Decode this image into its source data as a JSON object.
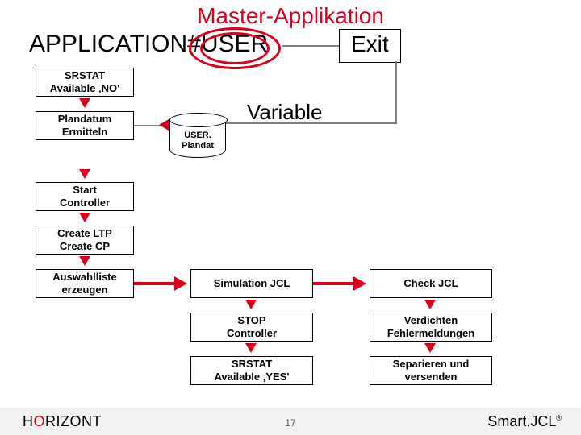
{
  "title": "Master-Applikation",
  "subtitle": "APPLICATION#USER",
  "exit_label": "Exit",
  "variable_label": "Variable",
  "db": {
    "line1": "USER.",
    "line2": "Plandat"
  },
  "left_boxes": {
    "b1": {
      "l1": "SRSTAT",
      "l2": "Available ‚NO'"
    },
    "b2": {
      "l1": "Plandatum",
      "l2": "Ermitteln"
    },
    "b3": {
      "l1": "Start",
      "l2": "Controller"
    },
    "b4": {
      "l1": "Create LTP",
      "l2": "Create CP"
    },
    "b5": {
      "l1": "Auswahlliste",
      "l2": "erzeugen"
    }
  },
  "mid_boxes": {
    "m1": "Simulation JCL",
    "m2a": "STOP",
    "m2b": "Controller",
    "m3a": "SRSTAT",
    "m3b": "Available ‚YES'"
  },
  "right_boxes": {
    "r1": "Check JCL",
    "r2a": "Verdichten",
    "r2b": "Fehlermeldungen",
    "r3a": "Separieren und",
    "r3b": "versenden"
  },
  "footer": {
    "brand_left_1": "H",
    "brand_left_2": "O",
    "brand_left_3": "RIZONT",
    "brand_right_1": "Smart",
    "brand_right_2": ".JCL",
    "brand_right_reg": "®",
    "page": "17"
  }
}
